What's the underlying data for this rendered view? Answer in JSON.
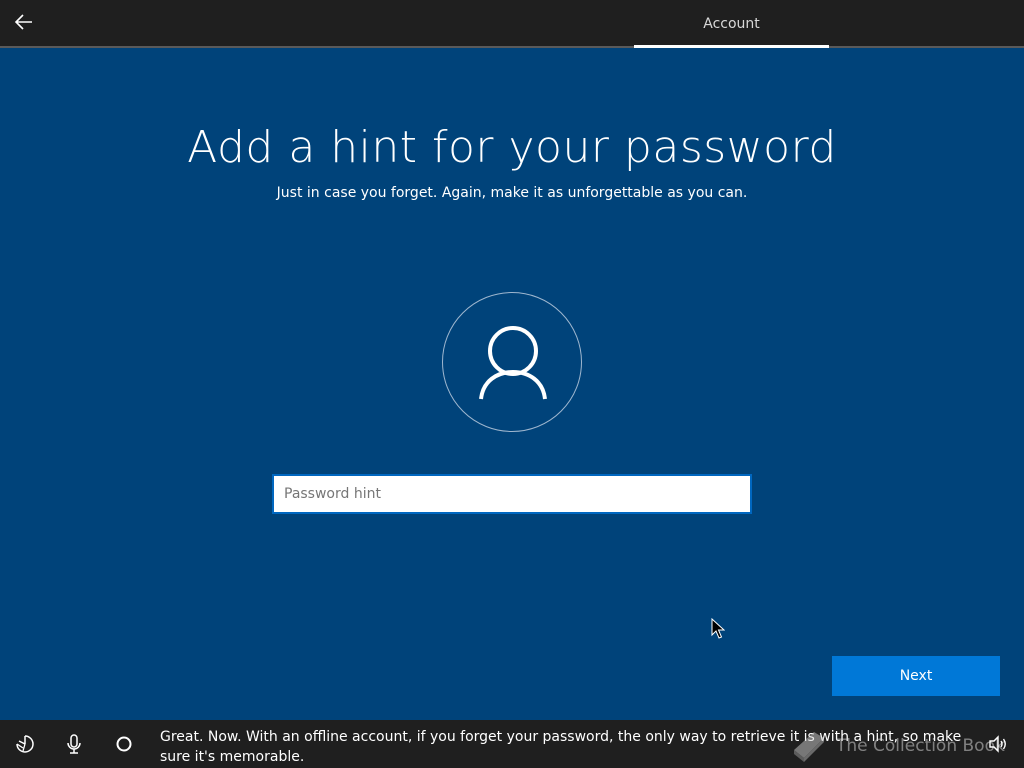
{
  "header": {
    "back_icon": "arrow-left-icon",
    "tab_label": "Account"
  },
  "main": {
    "title": "Add a hint for your password",
    "subtitle": "Just in case you forget. Again, make it as unforgettable as you can.",
    "avatar_icon": "user-icon",
    "hint_input": {
      "value": "",
      "placeholder": "Password hint"
    },
    "next_label": "Next"
  },
  "footer": {
    "icons": [
      "ease-of-access-icon",
      "microphone-icon",
      "cortana-icon",
      "volume-icon"
    ],
    "caption": "Great. Now. With an offline account, if you forget your password, the only way to retrieve it is with a hint, so make sure it's memorable.",
    "watermark": "The Collection Book"
  },
  "colors": {
    "background": "#00437a",
    "bars": "#1f1f1f",
    "accent": "#0078d7"
  }
}
